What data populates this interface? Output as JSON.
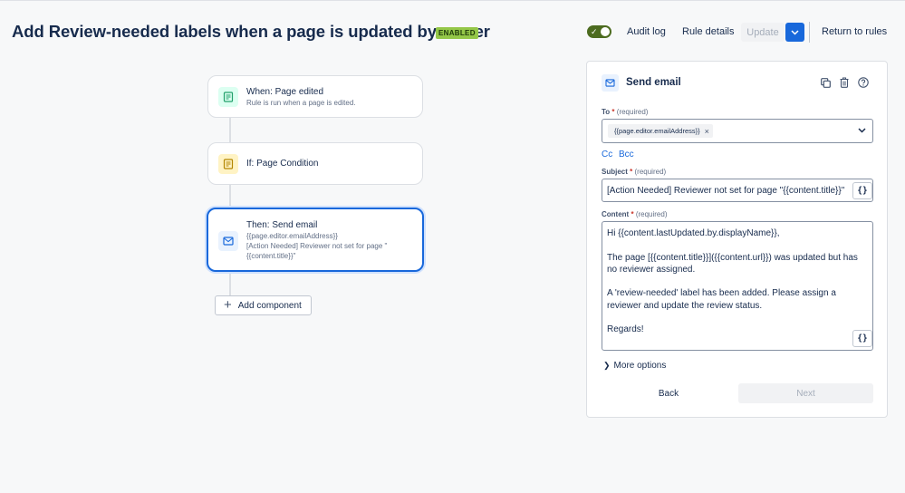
{
  "header": {
    "title": "Add Review-needed labels when a page is updated by a user",
    "status_badge": "ENABLED",
    "toggle_on": true,
    "audit_log": "Audit log",
    "rule_details": "Rule details",
    "update": "Update",
    "return_to_rules": "Return to rules"
  },
  "flow": {
    "trigger": {
      "title": "When: Page edited",
      "subtitle": "Rule is run when a page is edited.",
      "icon": "page-icon",
      "color": "#e3fcef"
    },
    "condition": {
      "title": "If: Page Condition",
      "icon": "page-icon",
      "color": "#fff7d6"
    },
    "action": {
      "title": "Then: Send email",
      "lines": [
        "{{page.editor.emailAddress}}",
        "[Action Needed] Reviewer not set for page \"",
        "{{content.title}}\""
      ],
      "icon": "mail-icon",
      "color": "#e9f2fe"
    },
    "add_component": "Add component"
  },
  "panel": {
    "title": "Send email",
    "to": {
      "label": "To",
      "required": "(required)",
      "chip": "{{page.editor.emailAddress}}"
    },
    "cc": "Cc",
    "bcc": "Bcc",
    "subject": {
      "label": "Subject",
      "required": "(required)",
      "value": "[Action Needed] Reviewer not set for page \"{{content.title}}\""
    },
    "content": {
      "label": "Content",
      "required": "(required)",
      "paragraphs": [
        "Hi {{content.lastUpdated.by.displayName}},",
        "The page [{{content.title}}]({{content.url}}) was updated but has no reviewer assigned.",
        "A 'review-needed' label has been added. Please assign a reviewer and update the review status.",
        "Regards!"
      ]
    },
    "more_options": "More options",
    "back": "Back",
    "next": "Next"
  },
  "colors": {
    "accent": "#1868db",
    "enabled_badge": "#94c748",
    "toggle": "#4c6b1f"
  }
}
